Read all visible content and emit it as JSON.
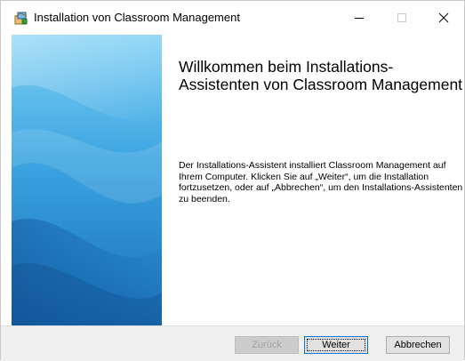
{
  "window": {
    "title": "Installation von Classroom Management",
    "controls": [
      "minimize",
      "maximize",
      "close"
    ]
  },
  "content": {
    "heading": "Willkommen beim Installations-Assistenten von Classroom Management",
    "description": "Der Installations-Assistent installiert Classroom Management auf Ihrem Computer. Klicken Sie auf „Weiter“, um die Installation fortzusetzen, oder auf „Abbrechen“, um den Installations-Assistenten zu beenden."
  },
  "buttons": {
    "back": "Zurück",
    "next": "Weiter",
    "cancel": "Abbrechen"
  },
  "colors": {
    "banner_light": "#7fd0f5",
    "banner_dark": "#1a6fb7",
    "accent": "#0078d7"
  },
  "icons": {
    "app": "installer-package-icon",
    "minimize": "minimize-icon",
    "maximize": "maximize-icon",
    "close": "close-icon"
  }
}
